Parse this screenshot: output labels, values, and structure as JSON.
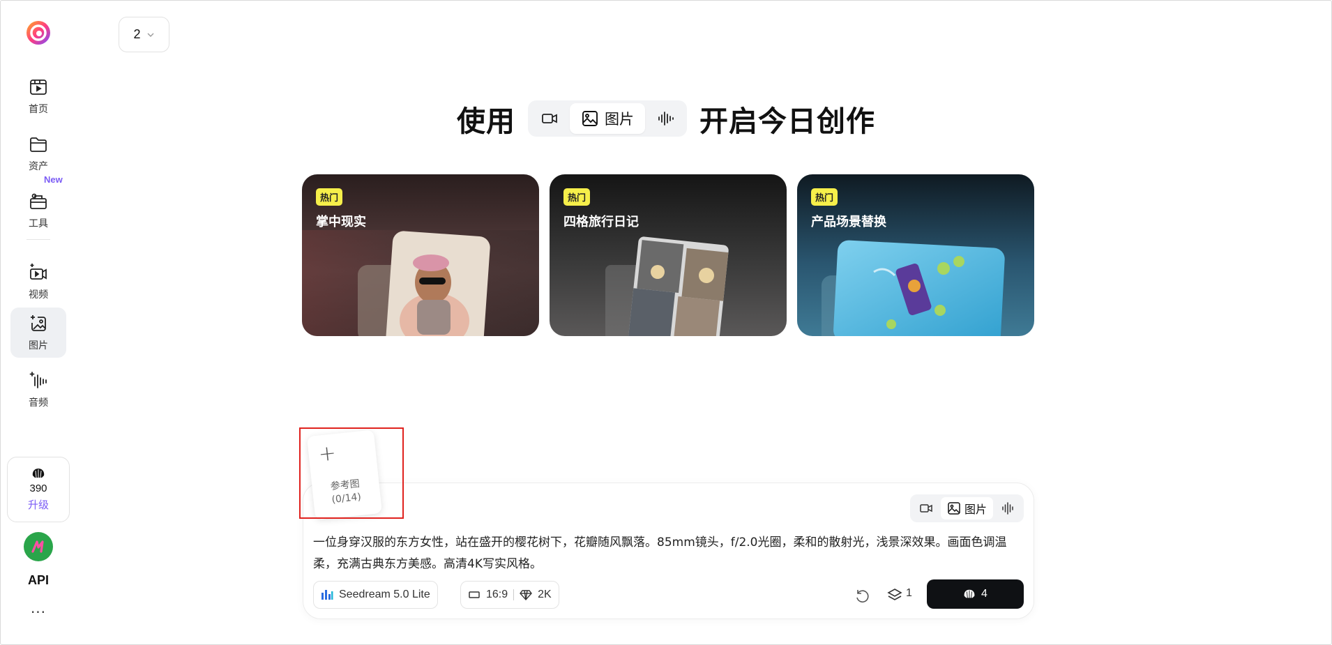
{
  "sidebar": {
    "items": [
      {
        "label": "首页",
        "icon": "home-play-icon"
      },
      {
        "label": "资产",
        "icon": "folder-icon"
      },
      {
        "label": "工具",
        "icon": "toolbox-icon",
        "badge": "New"
      },
      {
        "label": "视频",
        "icon": "video-sparkle-icon"
      },
      {
        "label": "图片",
        "icon": "image-sparkle-icon",
        "active": true
      },
      {
        "label": "音频",
        "icon": "audio-sparkle-icon"
      }
    ],
    "credits": {
      "value": "390",
      "upgrade_label": "升级"
    },
    "api_label": "API",
    "more_label": "···"
  },
  "page_select": {
    "value": "2"
  },
  "hero": {
    "prefix": "使用",
    "suffix": "开启今日创作",
    "modes": [
      {
        "label": "",
        "icon": "video-icon"
      },
      {
        "label": "图片",
        "icon": "image-icon",
        "active": true
      },
      {
        "label": "",
        "icon": "audio-wave-icon"
      }
    ]
  },
  "cards": [
    {
      "badge": "热门",
      "title": "掌中现实"
    },
    {
      "badge": "热门",
      "title": "四格旅行日记"
    },
    {
      "badge": "热门",
      "title": "产品场景替换"
    }
  ],
  "reference": {
    "plus": "+",
    "label": "参考图",
    "count": "(0/14)"
  },
  "composer": {
    "mini_modes": [
      {
        "label": "",
        "icon": "video-icon"
      },
      {
        "label": "图片",
        "icon": "image-icon",
        "active": true
      },
      {
        "label": "",
        "icon": "audio-wave-icon"
      }
    ],
    "prompt": "一位身穿汉服的东方女性，站在盛开的樱花树下，花瓣随风飘落。85mm镜头，f/2.0光圈，柔和的散射光，浅景深效果。画面色调温柔，充满古典东方美感。高清4K写实风格。",
    "model": "Seedream 5.0 Lite",
    "ratio": "16:9",
    "resolution": "2K",
    "layer_count": "1",
    "generate_cost": "4"
  },
  "colors": {
    "accent": "#7b5cf5",
    "badge": "#f6ef4a",
    "highlight_border": "#e0221e",
    "generate_bg": "#0f1114"
  }
}
